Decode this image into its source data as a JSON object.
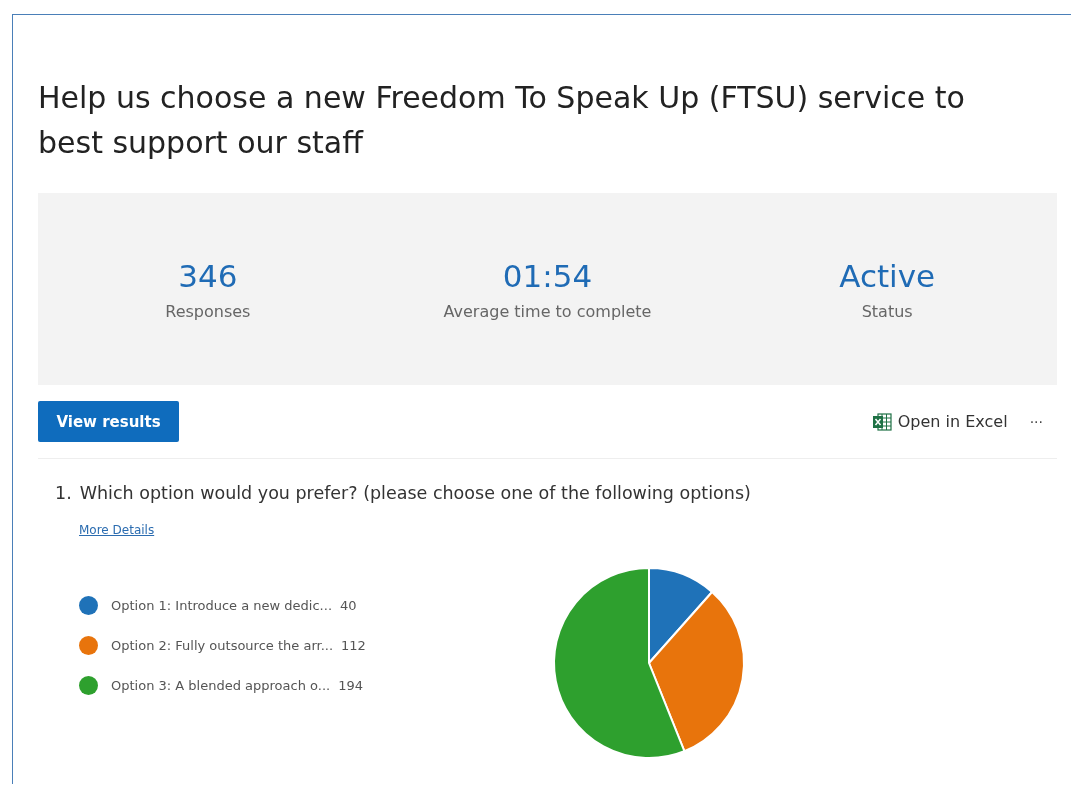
{
  "form": {
    "title": "Help us choose a new Freedom To Speak Up (FTSU) service to best support our staff"
  },
  "stats": [
    {
      "value": "346",
      "label": "Responses"
    },
    {
      "value": "01:54",
      "label": "Average time to complete"
    },
    {
      "value": "Active",
      "label": "Status"
    }
  ],
  "toolbar": {
    "view_results": "View results",
    "open_in_excel": "Open in Excel",
    "more": "···"
  },
  "question": {
    "number": "1.",
    "text": "Which option would you prefer? (please choose one of the following options)",
    "details_link": "More Details",
    "legend": [
      {
        "count": "40",
        "color": "#1f72b8"
      },
      {
        "count": "112",
        "color": "#e8740c"
      },
      {
        "count": "194",
        "color": "#2ea02e"
      }
    ],
    "chart_data": {
      "type": "pie",
      "categories": [
        "Option 1: Introduce a new dedic...",
        "Option 2: Fully outsource the arr...",
        "Option 3: A blended approach o..."
      ],
      "values": [
        11.56,
        32.37,
        56.07
      ]
    }
  }
}
